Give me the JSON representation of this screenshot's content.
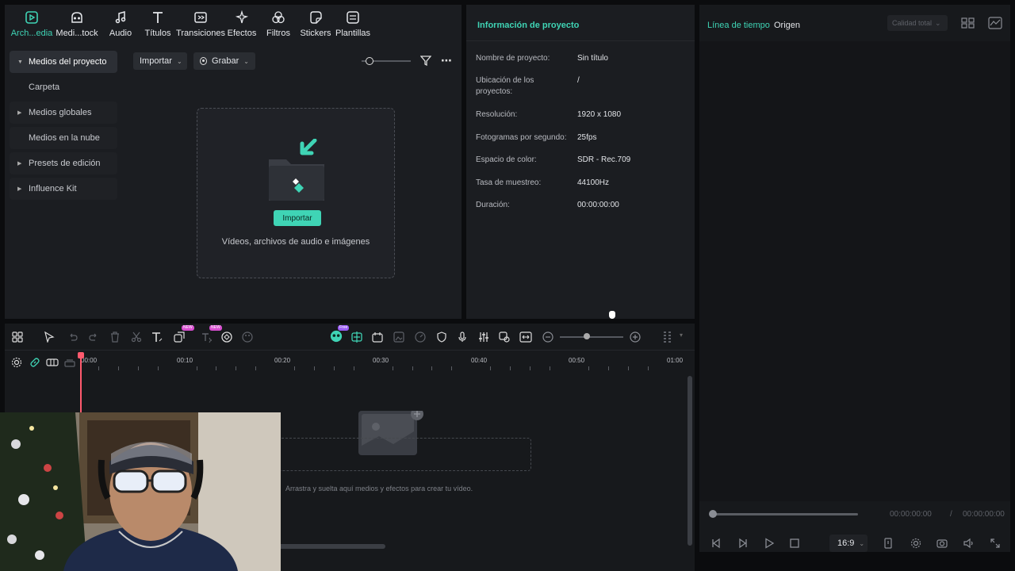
{
  "toolbar": {
    "tabs": [
      {
        "label": "Arch...edia",
        "icon": "media-icon",
        "active": true
      },
      {
        "label": "Medi...tock",
        "icon": "stock-icon"
      },
      {
        "label": "Audio",
        "icon": "music-note-icon"
      },
      {
        "label": "Títulos",
        "icon": "text-t-icon"
      },
      {
        "label": "Transiciones",
        "icon": "transition-icon"
      },
      {
        "label": "Efectos",
        "icon": "effects-sparkle-icon"
      },
      {
        "label": "Filtros",
        "icon": "filter-circles-icon"
      },
      {
        "label": "Stickers",
        "icon": "sticker-icon"
      },
      {
        "label": "Plantillas",
        "icon": "template-icon"
      }
    ]
  },
  "sidebar": {
    "items": [
      {
        "label": "Medios del proyecto",
        "caret": "▼"
      },
      {
        "label": "Carpeta",
        "caret": ""
      },
      {
        "label": "Medios globales",
        "caret": "▶"
      },
      {
        "label": "Medios en la nube",
        "caret": ""
      },
      {
        "label": "Presets de edición",
        "caret": "▶"
      },
      {
        "label": "Influence Kit",
        "caret": "▶"
      }
    ]
  },
  "media": {
    "import_label": "Importar",
    "record_label": "Grabar",
    "import_button": "Importar",
    "drop_hint": "Vídeos, archivos de audio e imágenes"
  },
  "project_info": {
    "title": "Información de proyecto",
    "rows": [
      {
        "key": "Nombre de proyecto:",
        "value": "Sin título"
      },
      {
        "key": "Ubicación de los proyectos:",
        "value": "/"
      },
      {
        "key": "Resolución:",
        "value": "1920 x 1080"
      },
      {
        "key": "Fotogramas por segundo:",
        "value": "25fps"
      },
      {
        "key": "Espacio de color:",
        "value": "SDR - Rec.709"
      },
      {
        "key": "Tasa de muestreo:",
        "value": "44100Hz"
      },
      {
        "key": "Duración:",
        "value": "00:00:00:00"
      }
    ]
  },
  "player": {
    "tab_timeline": "Línea de tiempo",
    "tab_source": "Origen",
    "quality": "Calidad total",
    "current_time": "00:00:00:00",
    "separator": "/",
    "total_time": "00:00:00:00",
    "aspect": "16:9"
  },
  "timeline": {
    "ruler": [
      "00:00",
      "00:10",
      "00:20",
      "00:30",
      "00:40",
      "00:50",
      "01:00"
    ],
    "track_hint": "Arrastra y suelta aquí medios y efectos para crear tu vídeo.",
    "badge_new": "NEW",
    "badge_free": "Free"
  },
  "colors": {
    "accent": "#3fd4b5",
    "playhead": "#ff5a6e"
  }
}
